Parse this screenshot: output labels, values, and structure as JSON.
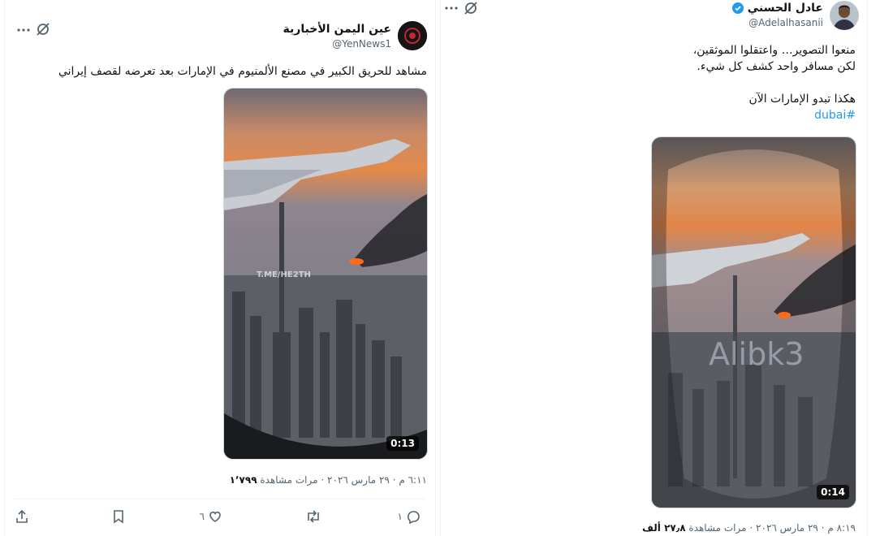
{
  "left": {
    "author_name": "عين اليمن الأخبارية",
    "author_handle": "@YenNews1",
    "text": "مشاهد للحريق الكبير في مصنع الألمنيوم في الإمارات بعد تعرضه لقصف إيراني",
    "video": {
      "duration": "0:13",
      "watermark": "T.ME/HE2TH"
    },
    "time": "٦:١١ م",
    "date": "٢٩ مارس ٢٠٢٦",
    "views_count": "١٬٧٩٩",
    "views_label": "مرات مشاهدة",
    "sep": "·",
    "actions": {
      "replies": "١",
      "reposts": "",
      "likes": "٦",
      "bookmarks": "",
      "share": ""
    }
  },
  "right": {
    "author_name": "عادل الحسني",
    "author_handle": "@Adelalhasanii",
    "text_lines": [
      "منعوا التصوير… واعتقلوا الموثقين،",
      "لكن مسافر واحد كشف كل شيء.",
      "هكذا تبدو الإمارات الآن"
    ],
    "hashtag": "#dubai",
    "video": {
      "duration": "0:14",
      "watermark": "Alibk3"
    },
    "time": "٨:١٩ م",
    "date": "٢٩ مارس ٢٠٢٦",
    "views_count": "٢٧٫٨ ألف",
    "views_label": "مرات مشاهدة",
    "sep": "·"
  },
  "colors": {
    "accent": "#1d9bf0",
    "verified": "#1d9bf0",
    "muted": "#536471"
  },
  "icons": [
    "more-icon",
    "grok-icon",
    "verified-icon",
    "reply-icon",
    "repost-icon",
    "like-icon",
    "bookmark-icon",
    "share-icon"
  ]
}
